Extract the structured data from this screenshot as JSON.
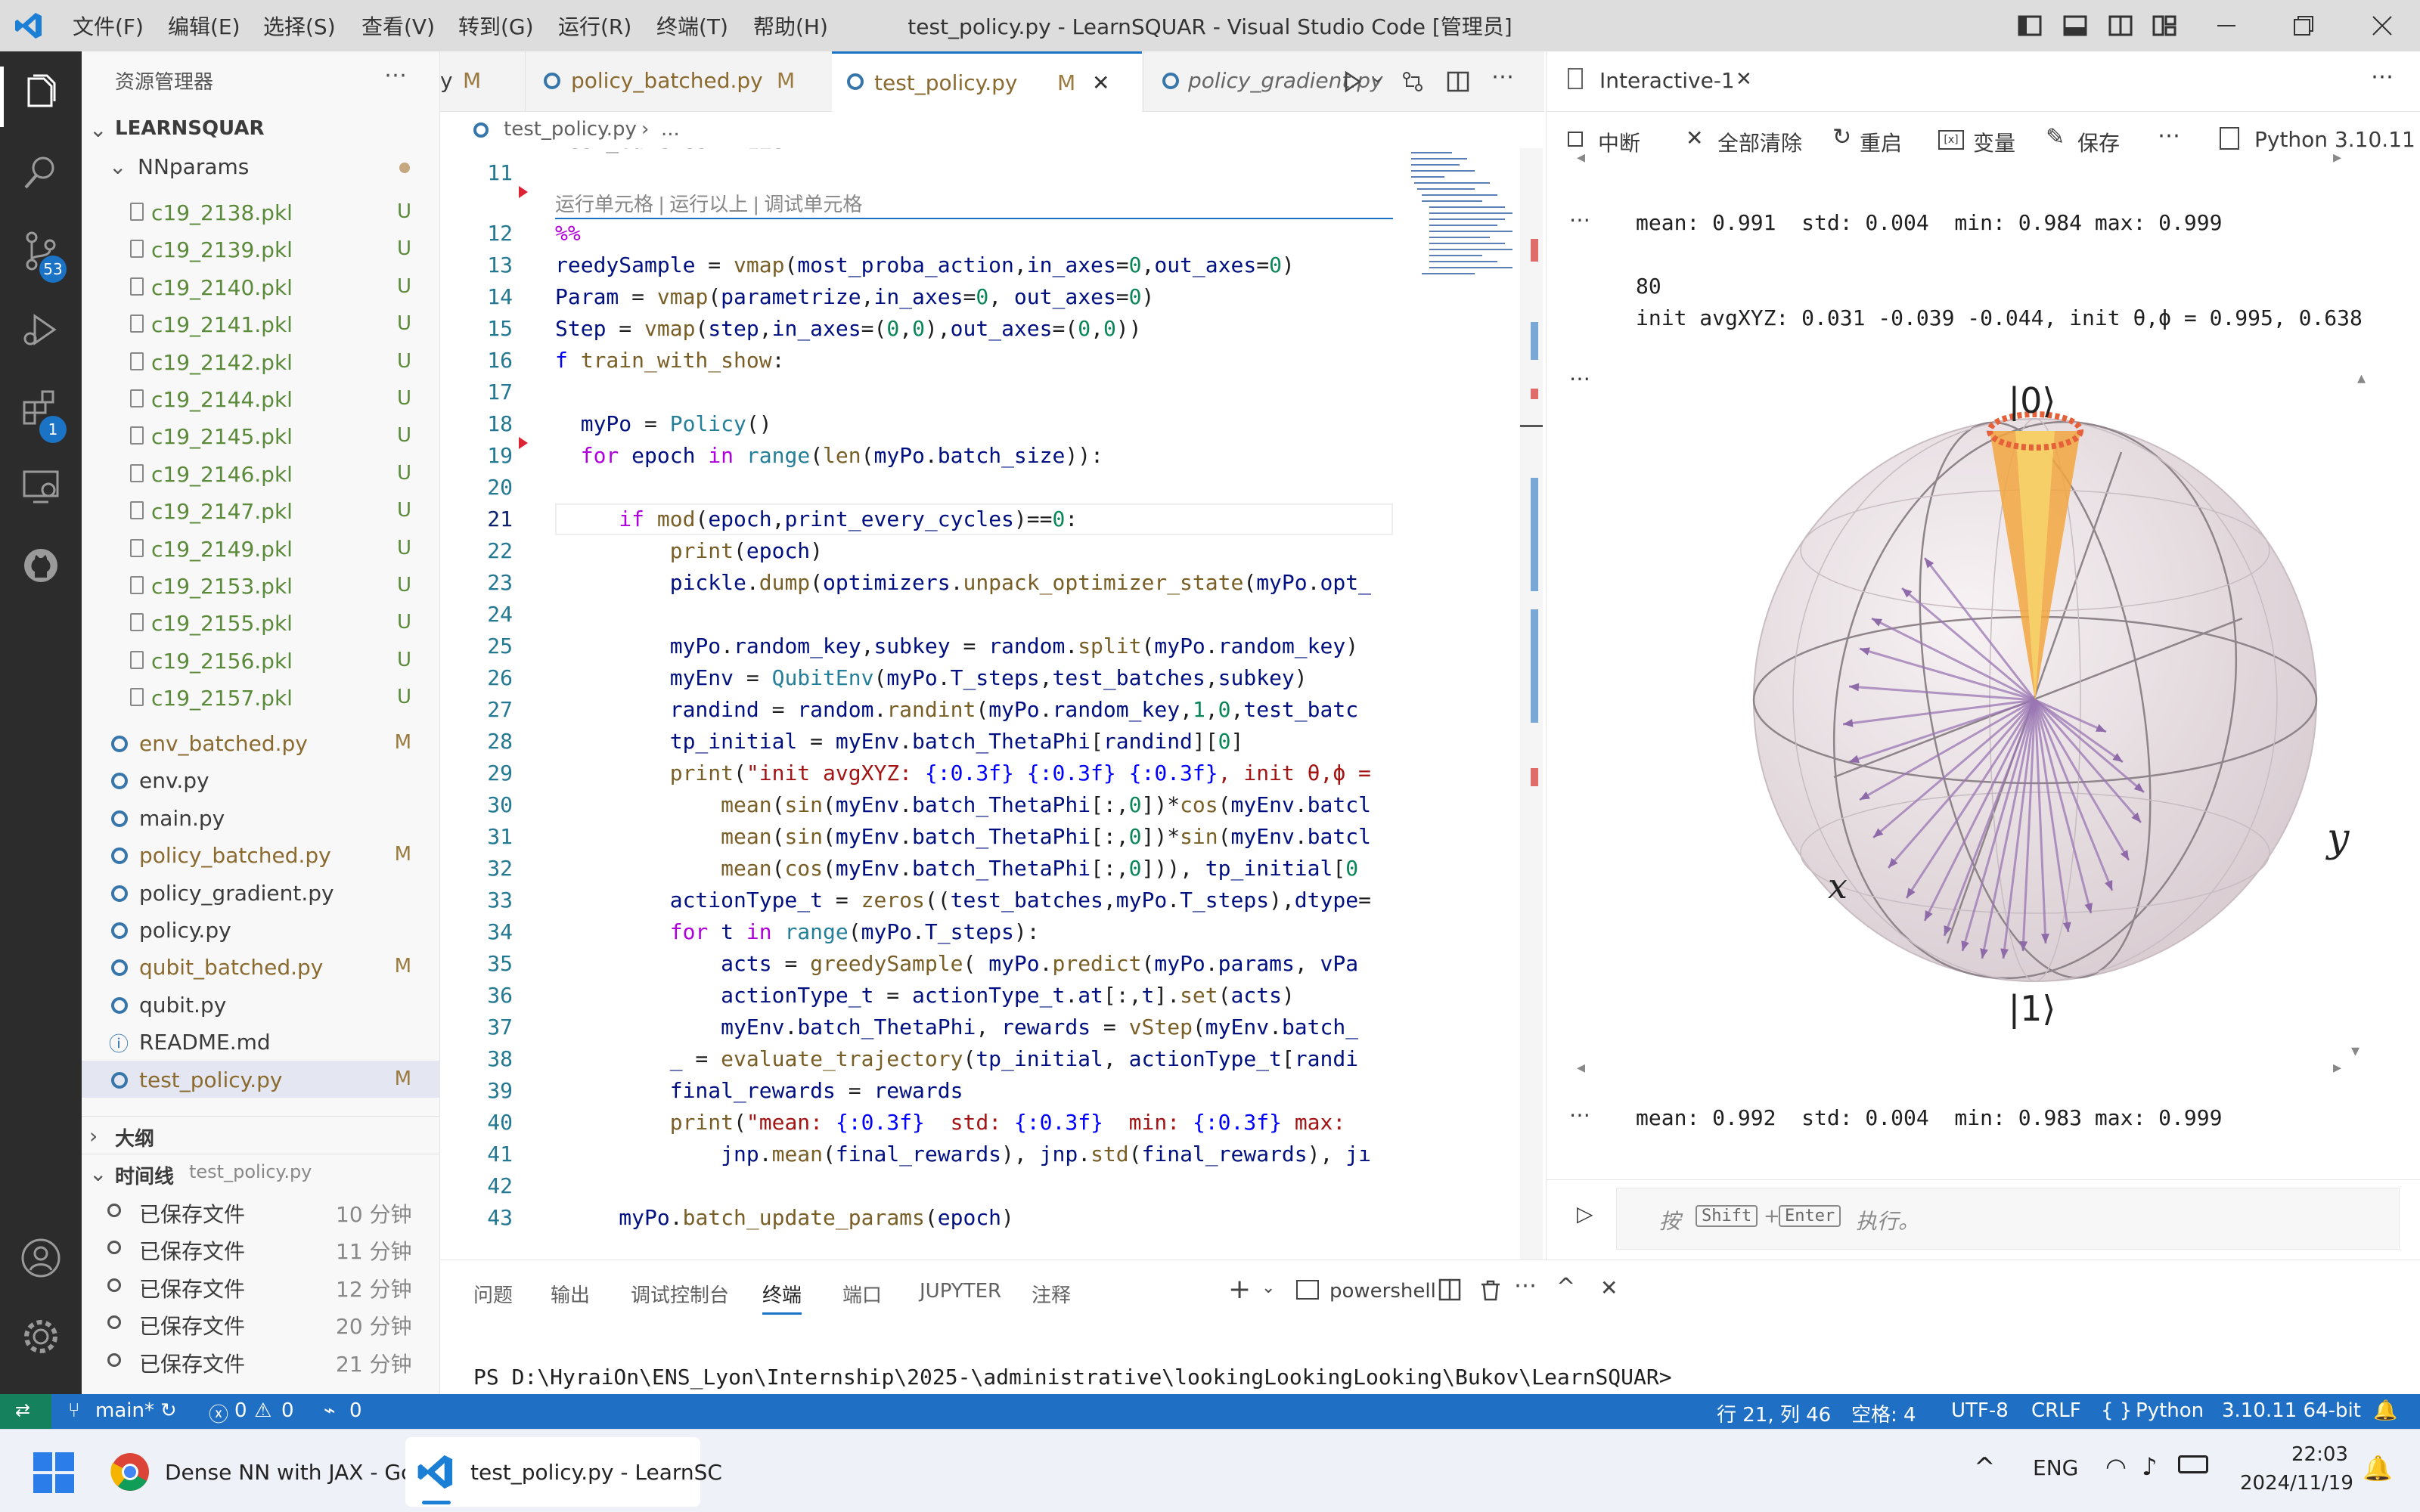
{
  "menu": [
    "文件(F)",
    "编辑(E)",
    "选择(S)",
    "查看(V)",
    "转到(G)",
    "运行(R)",
    "终端(T)",
    "帮助(H)"
  ],
  "window_title": "test_policy.py - LearnSQUAR - Visual Studio Code [管理员]",
  "activity": {
    "scm_badge": "53",
    "ext_badge": "1"
  },
  "sidebar": {
    "header": "资源管理器",
    "project": "LEARNSQUAR",
    "folder": "NNparams",
    "pkl_files": [
      {
        "name": "c19_2138.pkl",
        "status": "U"
      },
      {
        "name": "c19_2139.pkl",
        "status": "U"
      },
      {
        "name": "c19_2140.pkl",
        "status": "U"
      },
      {
        "name": "c19_2141.pkl",
        "status": "U"
      },
      {
        "name": "c19_2142.pkl",
        "status": "U"
      },
      {
        "name": "c19_2144.pkl",
        "status": "U"
      },
      {
        "name": "c19_2145.pkl",
        "status": "U"
      },
      {
        "name": "c19_2146.pkl",
        "status": "U"
      },
      {
        "name": "c19_2147.pkl",
        "status": "U"
      },
      {
        "name": "c19_2149.pkl",
        "status": "U"
      },
      {
        "name": "c19_2153.pkl",
        "status": "U"
      },
      {
        "name": "c19_2155.pkl",
        "status": "U"
      },
      {
        "name": "c19_2156.pkl",
        "status": "U"
      },
      {
        "name": "c19_2157.pkl",
        "status": "U"
      }
    ],
    "files": [
      {
        "name": "env_batched.py",
        "status": "M"
      },
      {
        "name": "env.py",
        "status": ""
      },
      {
        "name": "main.py",
        "status": ""
      },
      {
        "name": "policy_batched.py",
        "status": "M"
      },
      {
        "name": "policy_gradient.py",
        "status": ""
      },
      {
        "name": "policy.py",
        "status": ""
      },
      {
        "name": "qubit_batched.py",
        "status": "M"
      },
      {
        "name": "qubit.py",
        "status": ""
      },
      {
        "name": "README.md",
        "status": ""
      },
      {
        "name": "test_policy.py",
        "status": "M"
      }
    ],
    "outline": "大纲",
    "timeline": "时间线",
    "timeline_file": "test_policy.py",
    "timeline_items": [
      {
        "label": "已保存文件",
        "time": "10 分钟"
      },
      {
        "label": "已保存文件",
        "time": "11 分钟"
      },
      {
        "label": "已保存文件",
        "time": "12 分钟"
      },
      {
        "label": "已保存文件",
        "time": "20 分钟"
      },
      {
        "label": "已保存文件",
        "time": "21 分钟"
      }
    ]
  },
  "tabs": [
    {
      "name": "y",
      "status": "M"
    },
    {
      "name": "policy_batched.py",
      "status": "M"
    },
    {
      "name": "test_policy.py",
      "status": "M"
    },
    {
      "name": "policy_gradient.py",
      "status": ""
    }
  ],
  "breadcrumb": {
    "file": "test_policy.py",
    "rest": "..."
  },
  "editor": {
    "codelens": "运行单元格 | 运行以上 | 调试单元格",
    "line_numbers": [
      "11",
      "12",
      "13",
      "14",
      "15",
      "16",
      "17",
      "18",
      "19",
      "20",
      "21",
      "22",
      "23",
      "24",
      "25",
      "26",
      "27",
      "28",
      "29",
      "30",
      "31",
      "32",
      "33",
      "34",
      "35",
      "36",
      "37",
      "38",
      "39",
      "40",
      "41",
      "42",
      "43"
    ]
  },
  "interactive": {
    "tab": "Interactive-1",
    "toolbar": {
      "interrupt": "中断",
      "clear": "全部清除",
      "restart": "重启",
      "variables": "变量",
      "save": "保存",
      "kernel": "Python 3.10.11"
    },
    "out1": "mean: 0.991  std: 0.004  min: 0.984 max: 0.999",
    "out2a": "80",
    "out2b": "init avgXYZ: 0.031 -0.039 -0.044, init θ,ϕ = 0.995, 0.638",
    "out3": "mean: 0.992  std: 0.004  min: 0.983 max: 0.999",
    "bloch": {
      "ket0": "|0⟩",
      "ket1": "|1⟩",
      "x": "x",
      "y": "y"
    },
    "input_hint": {
      "pre": "按",
      "key1": "Shift",
      "plus": "+",
      "key2": "Enter",
      "post": "执行。"
    }
  },
  "terminal": {
    "tabs": [
      "问题",
      "输出",
      "调试控制台",
      "终端",
      "端口",
      "JUPYTER",
      "注释"
    ],
    "active": "终端",
    "shell": "powershell",
    "prompt": "PS D:\\HyraiOn\\ENS_Lyon\\Internship\\2025-\\administrative\\lookingLookingLooking\\Bukov\\LearnSQUAR>"
  },
  "status": {
    "branch": "main*",
    "errors": "0",
    "warnings": "0",
    "ports": "0",
    "position": "行 21, 列 46",
    "spaces": "空格: 4",
    "encoding": "UTF-8",
    "eol": "CRLF",
    "language": "Python",
    "interpreter": "3.10.11 64-bit"
  },
  "taskbar": {
    "app1": "Dense NN with JAX - Gc",
    "app2": "test_policy.py - LearnSC",
    "lang": "ENG",
    "time": "22:03",
    "date": "2024/11/19"
  }
}
